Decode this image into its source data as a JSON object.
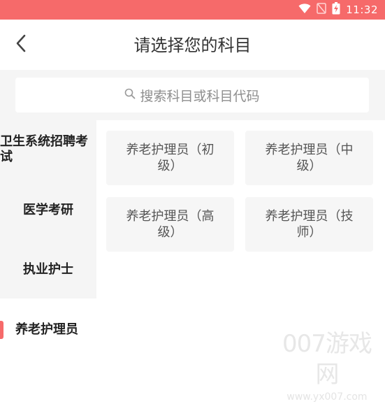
{
  "status_bar": {
    "time": "11:32",
    "color": "#f66a6a",
    "icons": [
      "wifi-icon",
      "no-signal-icon",
      "battery-charging-icon"
    ]
  },
  "header": {
    "title": "请选择您的科目",
    "back_icon": "chevron-left-icon"
  },
  "search": {
    "placeholder": "搜索科目或科目代码",
    "icon": "search-icon"
  },
  "sidebar": {
    "items": [
      {
        "label": "卫生系统招聘考试"
      },
      {
        "label": "医学考研"
      },
      {
        "label": "执业护士"
      }
    ]
  },
  "subjects": {
    "items": [
      {
        "label": "养老护理员（初级）"
      },
      {
        "label": "养老护理员（中级）"
      },
      {
        "label": "养老护理员（高级）"
      },
      {
        "label": "养老护理员（技师）"
      }
    ]
  },
  "current_category": {
    "label": "养老护理员"
  },
  "watermark": {
    "main": "007游戏网",
    "url": "www.yx007.com"
  },
  "colors": {
    "accent": "#f66a6a",
    "panel_bg": "#f5f5f5",
    "card_bg": "#f6f6f6"
  }
}
